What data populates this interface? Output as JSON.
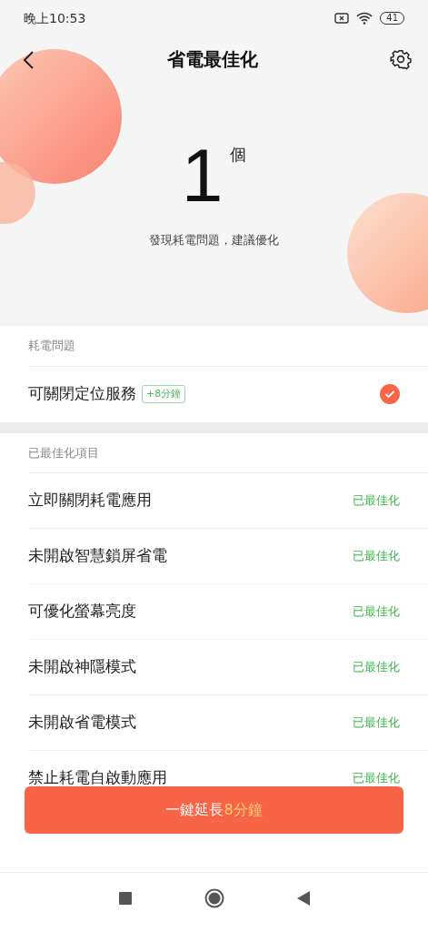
{
  "status_bar": {
    "time": "晚上10:53",
    "battery": "41"
  },
  "header": {
    "title": "省電最佳化"
  },
  "summary": {
    "count": "1",
    "unit": "個",
    "message": "發現耗電問題，建議優化"
  },
  "issues": {
    "heading": "耗電問題",
    "items": [
      {
        "label": "可關閉定位服務",
        "tag": "+8分鐘",
        "checked": true
      }
    ]
  },
  "optimized": {
    "heading": "已最佳化項目",
    "items": [
      {
        "label": "立即關閉耗電應用",
        "status": "已最佳化"
      },
      {
        "label": "未開啟智慧鎖屏省電",
        "status": "已最佳化"
      },
      {
        "label": "可優化螢幕亮度",
        "status": "已最佳化"
      },
      {
        "label": "未開啟神隱模式",
        "status": "已最佳化"
      },
      {
        "label": "未開啟省電模式",
        "status": "已最佳化"
      },
      {
        "label": "禁止耗電自啟動應用",
        "status": "已最佳化"
      }
    ]
  },
  "action_button": {
    "label": "一鍵延長",
    "highlight": "8分鐘"
  }
}
